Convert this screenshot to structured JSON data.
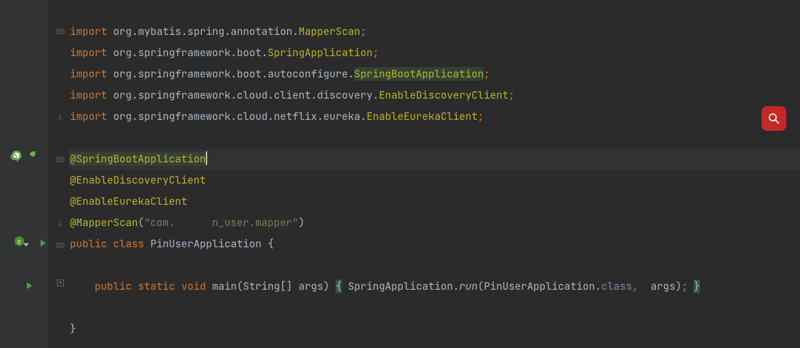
{
  "code": {
    "imports": [
      {
        "pkg_parts": [
          "org",
          "mybatis",
          "spring",
          "annotation"
        ],
        "class": "MapperScan"
      },
      {
        "pkg_parts": [
          "org",
          "springframework",
          "boot"
        ],
        "class": "SpringApplication"
      },
      {
        "pkg_parts": [
          "org",
          "springframework",
          "boot",
          "autoconfigure"
        ],
        "class": "SpringBootApplication",
        "highlight": true
      },
      {
        "pkg_parts": [
          "org",
          "springframework",
          "cloud",
          "client",
          "discovery"
        ],
        "class": "EnableDiscoveryClient"
      },
      {
        "pkg_parts": [
          "org",
          "springframework",
          "cloud",
          "netflix",
          "eureka"
        ],
        "class": "EnableEurekaClient"
      }
    ],
    "annotations": [
      {
        "name": "@SpringBootApplication",
        "highlight": true,
        "cursor": true
      },
      {
        "name": "@EnableDiscoveryClient"
      },
      {
        "name": "@EnableEurekaClient"
      },
      {
        "name": "@MapperScan",
        "arg_string": "\"com.      n_user.mapper\""
      }
    ],
    "kw_import": "import",
    "kw_public": "public",
    "kw_class": "class",
    "kw_static": "static",
    "kw_void": "void",
    "class_decl_name": "PinUserApplication",
    "main_method": "main",
    "main_params": "(String[] args)",
    "spring_app": "SpringApplication",
    "run_method": "run",
    "run_arg_class": "PinUserApplication",
    "dot_class": "class",
    "args_ident": "args",
    "open_brace": "{",
    "close_brace": "}",
    "open_paren": "(",
    "close_paren": ")",
    "semicolon": ";",
    "comma": ",",
    "dot": "."
  },
  "icons": {
    "search": "search-icon",
    "fold_minus": "fold-minus-icon",
    "fold_plus": "fold-plus-icon",
    "spring_bean": "spring-bean-icon",
    "run_gutter": "run-gutter-icon",
    "bean_gutter": "bean-gutter-icon"
  }
}
